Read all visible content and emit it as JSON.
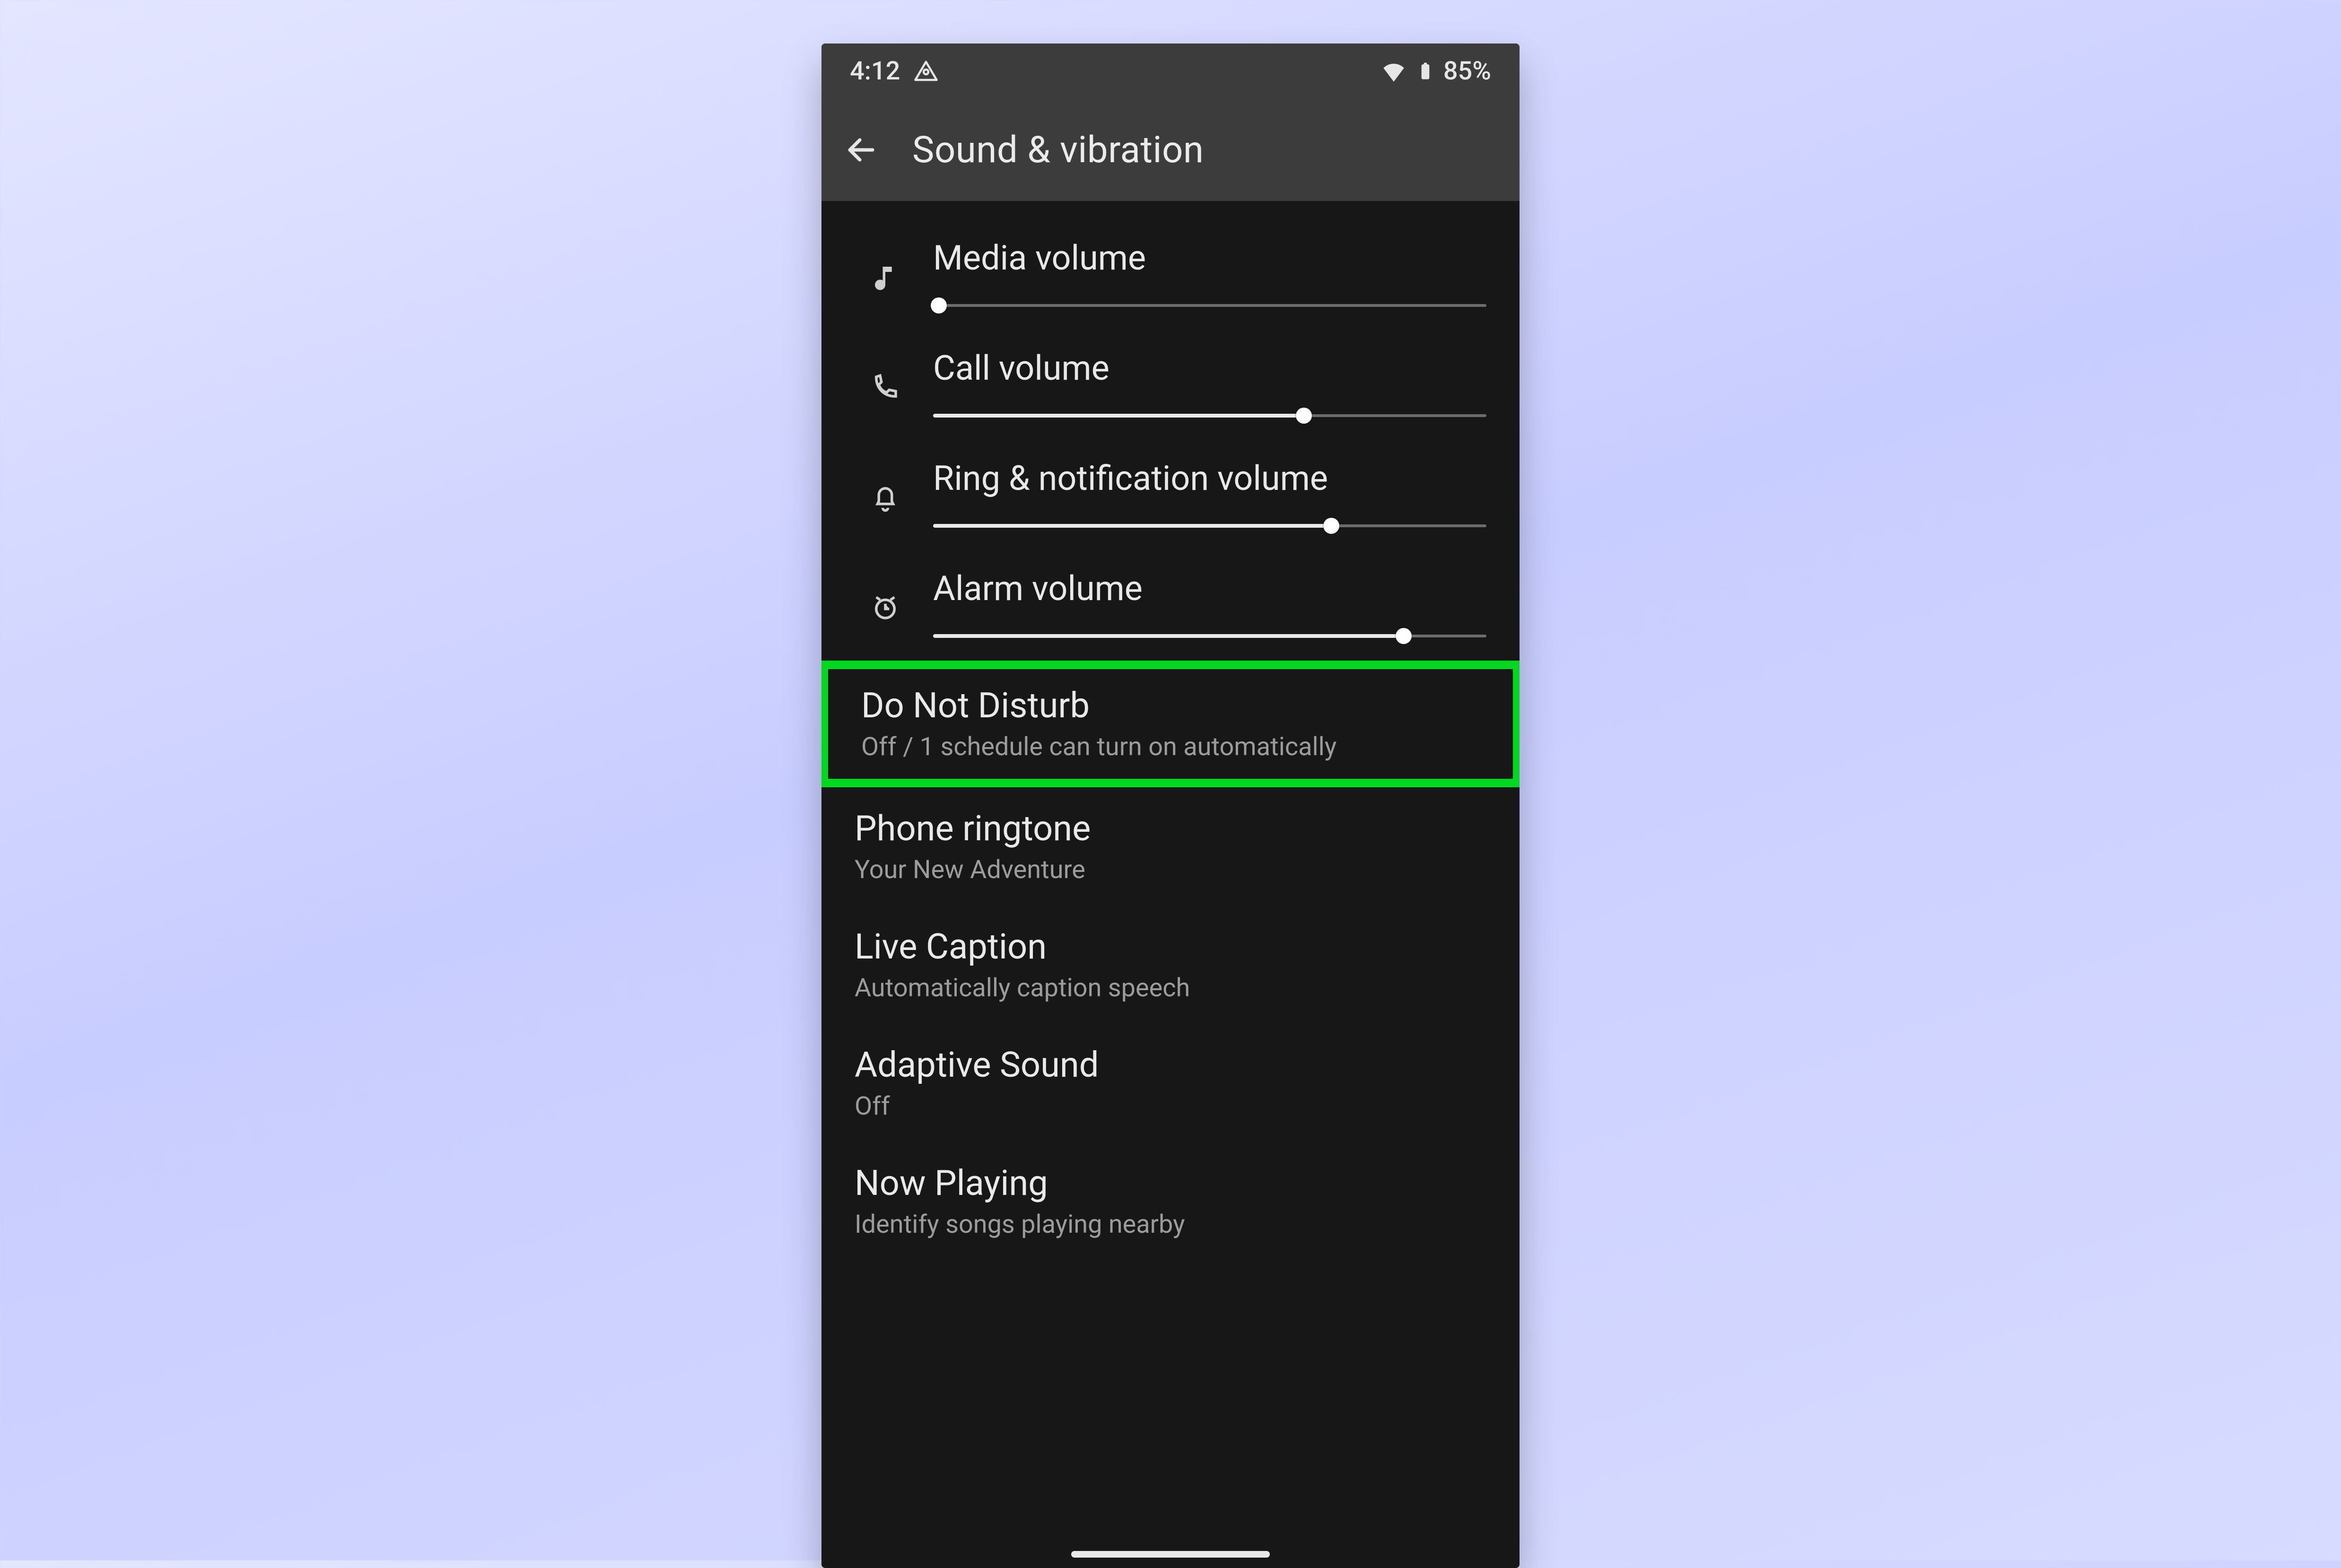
{
  "status": {
    "time": "4:12",
    "battery": "85%"
  },
  "appbar": {
    "title": "Sound & vibration"
  },
  "sliders": {
    "media": {
      "label": "Media volume",
      "pct": 1
    },
    "call": {
      "label": "Call volume",
      "pct": 67
    },
    "ring": {
      "label": "Ring & notification volume",
      "pct": 72
    },
    "alarm": {
      "label": "Alarm volume",
      "pct": 85
    }
  },
  "items": {
    "dnd": {
      "title": "Do Not Disturb",
      "sub": "Off / 1 schedule can turn on automatically",
      "highlighted": true
    },
    "ringtone": {
      "title": "Phone ringtone",
      "sub": "Your New Adventure"
    },
    "caption": {
      "title": "Live Caption",
      "sub": "Automatically caption speech"
    },
    "adaptive": {
      "title": "Adaptive Sound",
      "sub": "Off"
    },
    "now": {
      "title": "Now Playing",
      "sub": "Identify songs playing nearby"
    }
  }
}
